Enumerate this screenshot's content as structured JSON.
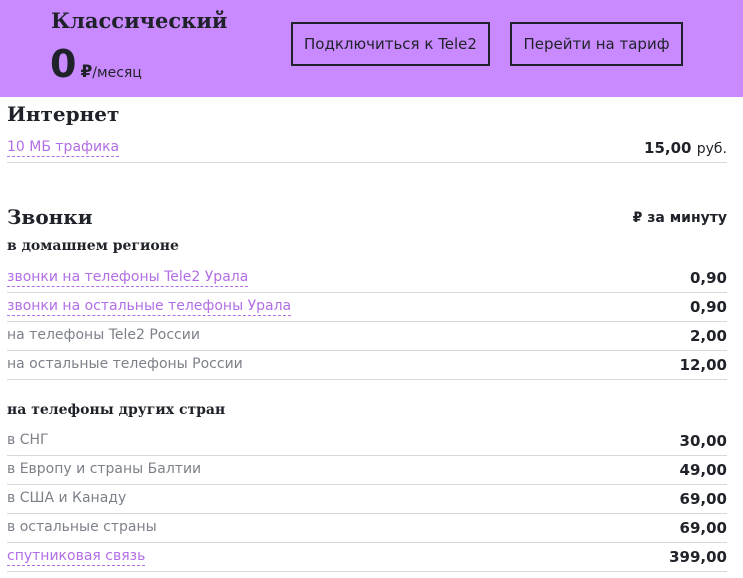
{
  "header": {
    "plan_name": "Классический",
    "price_value": "0",
    "price_currency": "₽",
    "price_unit": "/месяц",
    "connect_button": "Подключиться к Tele2",
    "switch_button": "Перейти на тариф",
    "bg_color": "#c98aff"
  },
  "internet": {
    "title": "Интернет",
    "rows": [
      {
        "label": "10 МБ трафика",
        "value": "15,00",
        "unit": "руб."
      }
    ]
  },
  "calls": {
    "title": "Звонки",
    "per_minute": "₽ за минуту",
    "home": {
      "subtitle": "в домашнем регионе",
      "rows": [
        {
          "label": "звонки на телефоны Tele2 Урала",
          "value": "0,90"
        },
        {
          "label": "звонки на остальные телефоны Урала",
          "value": "0,90"
        },
        {
          "label": "на телефоны Tele2 России",
          "value": "2,00"
        },
        {
          "label": "на остальные телефоны России",
          "value": "12,00"
        }
      ]
    },
    "intl": {
      "subtitle": "на телефоны других стран",
      "rows": [
        {
          "label": "в СНГ",
          "value": "30,00"
        },
        {
          "label": "в Европу и страны Балтии",
          "value": "49,00"
        },
        {
          "label": "в США и Канаду",
          "value": "69,00"
        },
        {
          "label": "в остальные страны",
          "value": "69,00"
        },
        {
          "label": "спутниковая связь",
          "value": "399,00"
        }
      ]
    }
  }
}
